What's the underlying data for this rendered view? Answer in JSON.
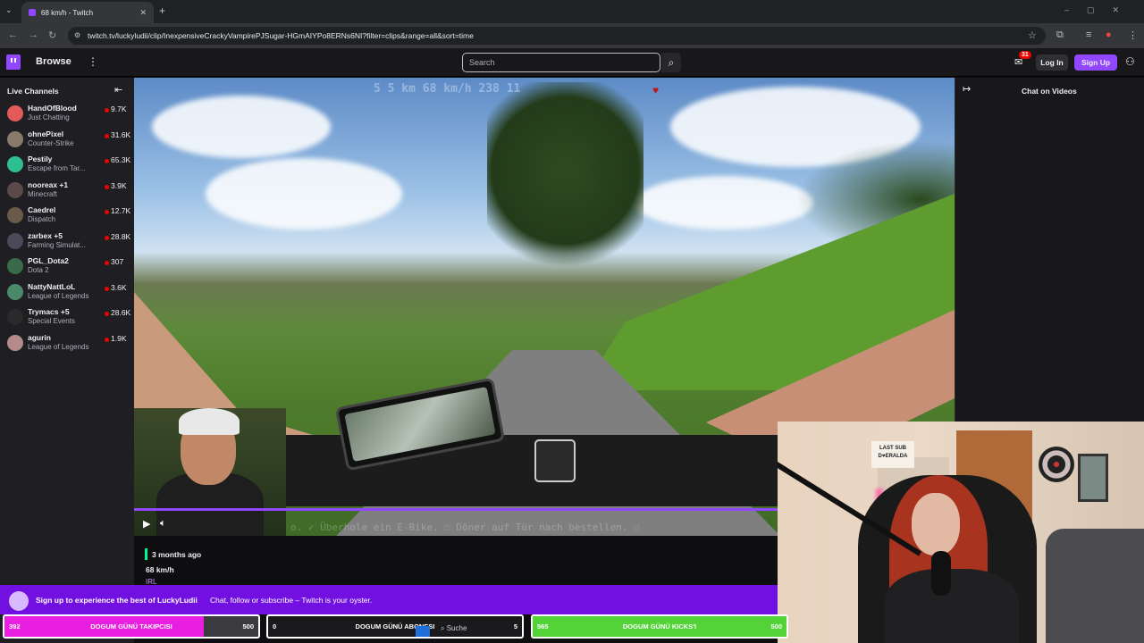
{
  "browser": {
    "tab_title": "68 km/h - Twitch",
    "url": "twitch.tv/luckyludii/clip/InexpensiveCrackyVampirePJSugar-HGmAIYPo8ERNs6NI?filter=clips&range=all&sort=time"
  },
  "header": {
    "browse": "Browse",
    "search_placeholder": "Search",
    "notif_count": "31",
    "login": "Log In",
    "signup": "Sign Up"
  },
  "sidebar": {
    "title": "Live Channels",
    "channels": [
      {
        "name": "HandOfBlood",
        "game": "Just Chatting",
        "viewers": "9.7K",
        "color": "#e45a5a"
      },
      {
        "name": "ohnePixel",
        "game": "Counter-Strike",
        "viewers": "31.6K",
        "color": "#8a7a6a"
      },
      {
        "name": "Pestily",
        "game": "Escape from Tar...",
        "viewers": "65.3K",
        "color": "#2fbf8f"
      },
      {
        "name": "nooreax +1",
        "game": "Minecraft",
        "viewers": "3.9K",
        "color": "#5a4a4a"
      },
      {
        "name": "Caedrel",
        "game": "Dispatch",
        "viewers": "12.7K",
        "color": "#6a5a4a"
      },
      {
        "name": "zarbex +5",
        "game": "Farming Simulat...",
        "viewers": "28.8K",
        "color": "#4a4a5a"
      },
      {
        "name": "PGL_Dota2",
        "game": "Dota 2",
        "viewers": "307",
        "color": "#3a6a4a"
      },
      {
        "name": "NattyNattLoL",
        "game": "League of Legends",
        "viewers": "3.6K",
        "color": "#4a8a6a"
      },
      {
        "name": "Trymacs +5",
        "game": "Special Events",
        "viewers": "28.6K",
        "color": "#2a2a2a"
      },
      {
        "name": "agurin",
        "game": "League of Legends",
        "viewers": "1.9K",
        "color": "#b58a8a"
      }
    ]
  },
  "video": {
    "overlay_stats": "5 5 km  68 km/h  238  11",
    "todo_text": "o. ✓ Überhole ein E-Bike. ☐ Döner auf Tür nach bestellen. ☐"
  },
  "clip": {
    "age": "3 months ago",
    "title": "68 km/h",
    "category": "IRL"
  },
  "chat": {
    "title": "Chat on Videos"
  },
  "webcam": {
    "sign_line1": "LAST SUB",
    "sign_line2": "D♥ERALDA"
  },
  "banner": {
    "headline": "Sign up to experience the best of LuckyLudii",
    "sub": "Chat, follow or subscribe – Twitch is your oyster."
  },
  "goals": [
    {
      "current": "392",
      "label": "DOGUM GÜNÜ TAKIPCISI",
      "target": "500",
      "fill_ratio": 0.784,
      "color": "#e81ee0"
    },
    {
      "current": "0",
      "label": "DOGUM GÜNÜ ABONESI",
      "target": "5",
      "fill_ratio": 0.0,
      "color": "#9146ff"
    },
    {
      "current": "565",
      "label": "DOGUM GÜNÜ KICKS'I",
      "target": "500",
      "fill_ratio": 1.0,
      "color": "#53d337"
    }
  ],
  "taskbar": {
    "search": "Suche"
  }
}
